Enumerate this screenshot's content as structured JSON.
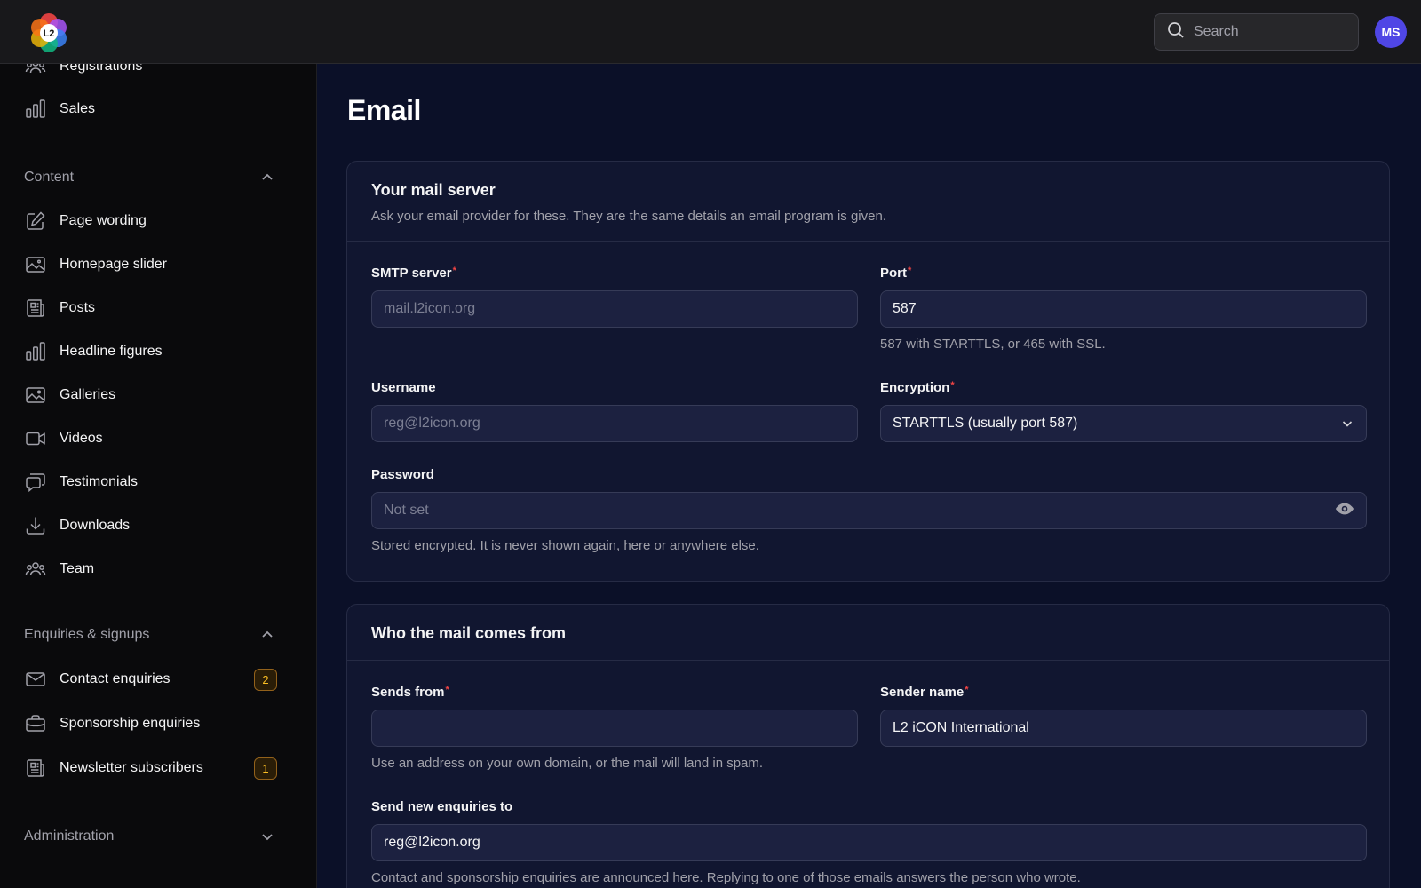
{
  "header": {
    "logo_text": "L2",
    "search_placeholder": "Search",
    "avatar_initials": "MS"
  },
  "sidebar": {
    "top_items": [
      {
        "label": "Registrations",
        "icon": "users-icon"
      },
      {
        "label": "Sales",
        "icon": "bar-chart-icon"
      }
    ],
    "groups": [
      {
        "title": "Content",
        "expanded": true,
        "items": [
          {
            "label": "Page wording",
            "icon": "pencil-square-icon"
          },
          {
            "label": "Homepage slider",
            "icon": "image-icon"
          },
          {
            "label": "Posts",
            "icon": "newspaper-icon"
          },
          {
            "label": "Headline figures",
            "icon": "bar-chart-icon"
          },
          {
            "label": "Galleries",
            "icon": "image-icon"
          },
          {
            "label": "Videos",
            "icon": "video-camera-icon"
          },
          {
            "label": "Testimonials",
            "icon": "chat-bubbles-icon"
          },
          {
            "label": "Downloads",
            "icon": "download-icon"
          },
          {
            "label": "Team",
            "icon": "users-icon"
          }
        ]
      },
      {
        "title": "Enquiries & signups",
        "expanded": true,
        "items": [
          {
            "label": "Contact enquiries",
            "icon": "envelope-icon",
            "badge": "2"
          },
          {
            "label": "Sponsorship enquiries",
            "icon": "briefcase-icon"
          },
          {
            "label": "Newsletter subscribers",
            "icon": "newspaper-icon",
            "badge": "1"
          }
        ]
      },
      {
        "title": "Administration",
        "expanded": false,
        "items": []
      }
    ]
  },
  "main": {
    "title": "Email",
    "mail_server": {
      "title": "Your mail server",
      "description": "Ask your email provider for these. They are the same details an email program is given.",
      "smtp": {
        "label": "SMTP server",
        "required": "*",
        "value": "",
        "placeholder": "mail.l2icon.org"
      },
      "port": {
        "label": "Port",
        "required": "*",
        "value": "587",
        "hint": "587 with STARTTLS, or 465 with SSL."
      },
      "username": {
        "label": "Username",
        "value": "",
        "placeholder": "reg@l2icon.org"
      },
      "encryption": {
        "label": "Encryption",
        "required": "*",
        "value": "STARTTLS (usually port 587)"
      },
      "password": {
        "label": "Password",
        "value": "",
        "placeholder": "Not set",
        "hint": "Stored encrypted. It is never shown again, here or anywhere else."
      }
    },
    "sender": {
      "title": "Who the mail comes from",
      "sends_from": {
        "label": "Sends from",
        "required": "*",
        "value": "",
        "hint": "Use an address on your own domain, or the mail will land in spam."
      },
      "sender_name": {
        "label": "Sender name",
        "required": "*",
        "value": "L2 iCON International"
      },
      "send_enquiries_to": {
        "label": "Send new enquiries to",
        "value": "reg@l2icon.org",
        "hint": "Contact and sponsorship enquiries are announced here. Replying to one of those emails answers the person who wrote."
      }
    }
  },
  "colors": {
    "accent": "#4f46e5",
    "badge_text": "#fbbf24",
    "required": "#ef4444",
    "main_bg": "#0b1028",
    "card_bg": "#111630"
  }
}
